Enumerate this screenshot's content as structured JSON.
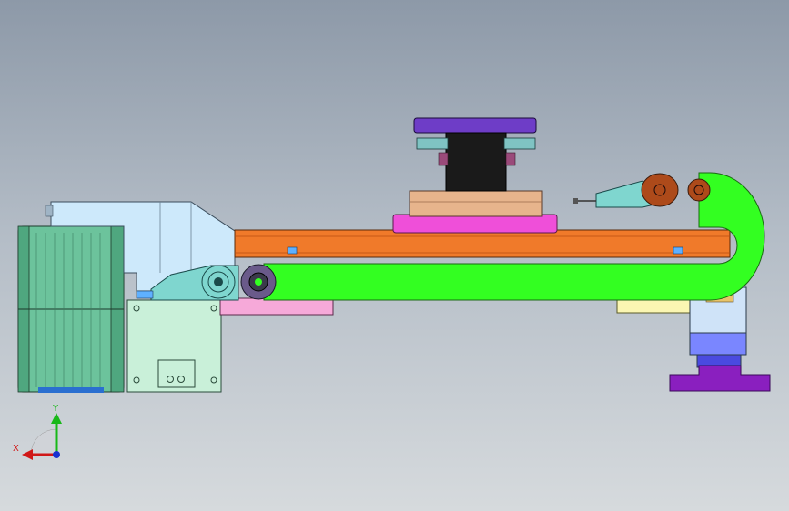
{
  "viewport": {
    "background_top": "#8d99a8",
    "background_bottom": "#d6dadd"
  },
  "model": {
    "parts": [
      "motor-left",
      "gearbox-housing",
      "motor-mount-block",
      "idler-roller",
      "drive-roller",
      "rail-beam",
      "cable-chain",
      "chain-end-link",
      "slide-carriage",
      "top-platform",
      "end-clamp",
      "right-mount-base"
    ],
    "colors": {
      "motor": "#6cc39c",
      "housing": "#cde9fb",
      "mount_block": "#c9f0d9",
      "rail": "#f07a2a",
      "chain": "#33ff21",
      "carriage_pink": "#ef4fd9",
      "platform": "#6e3dc7",
      "clamp": "#7fd6cf",
      "roller": "#ad4a1a",
      "base": "#8a1fbf"
    }
  },
  "triad": {
    "x_label": "X",
    "y_label": "Y",
    "x_color": "#d01818",
    "y_color": "#18b818",
    "z_color": "#1830d0"
  }
}
